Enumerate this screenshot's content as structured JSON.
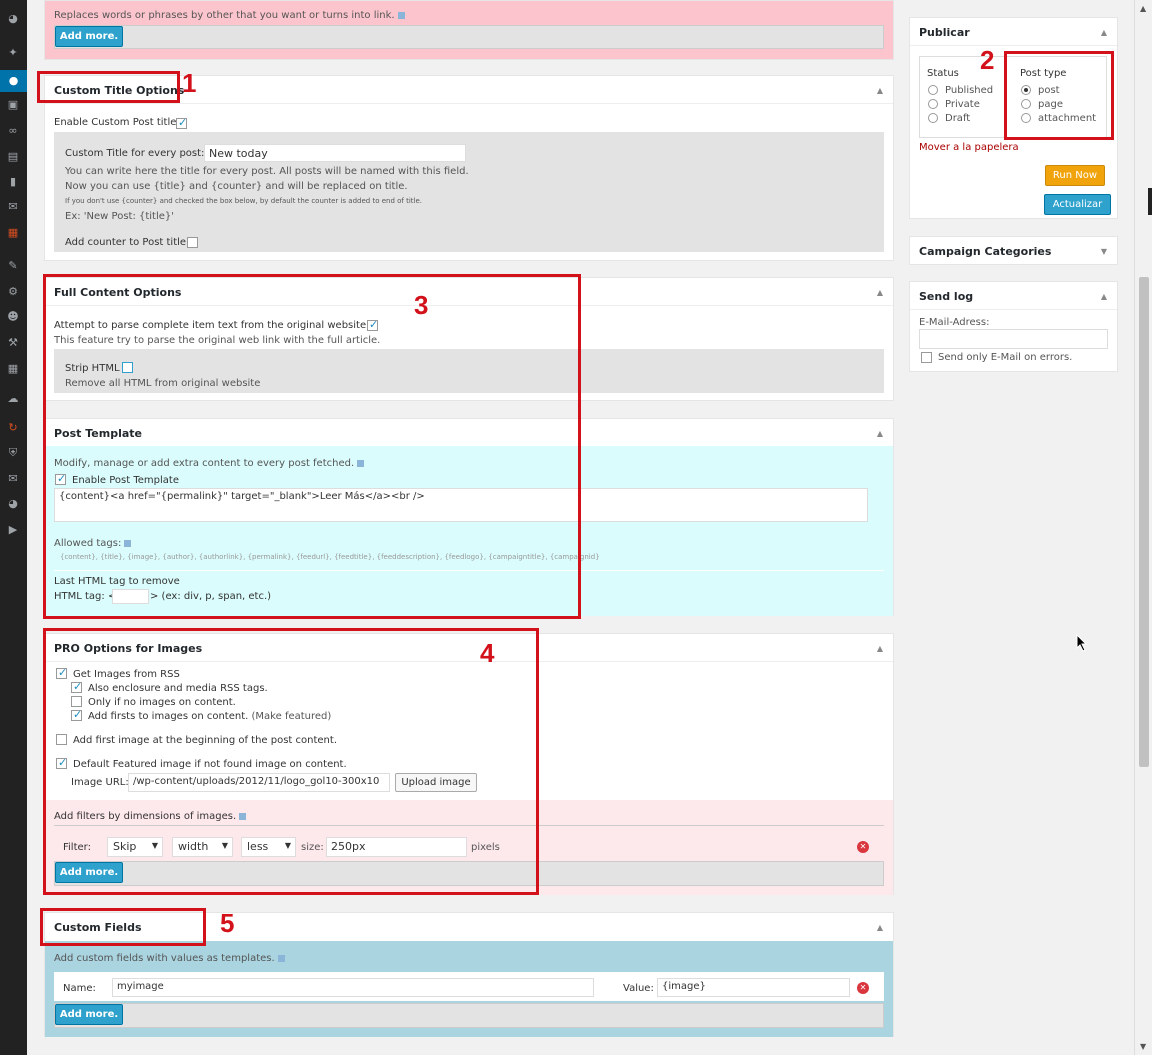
{
  "top_section": {
    "note": "Replaces words or phrases by other that you want or turns into link.",
    "add_more": "Add more."
  },
  "custom_title": {
    "heading": "Custom Title Options",
    "enable_label": "Enable Custom Post title",
    "field_label": "Custom Title for every post:",
    "field_value": "New today",
    "help1": "You can write here the title for every post. All posts will be named with this field.",
    "help2": "Now you can use {title} and {counter} and will be replaced on title.",
    "help3": "If you don't use {counter} and checked the box below, by default the counter is added to end of title.",
    "help4": "Ex: 'New Post: {title}'",
    "counter_label": "Add counter to Post title"
  },
  "full_content": {
    "heading": "Full Content Options",
    "parse_label": "Attempt to parse complete item text from the original website",
    "parse_help": "This feature try to parse the original web link with the full article.",
    "strip_label": "Strip HTML",
    "strip_help": "Remove all HTML from original website"
  },
  "post_template": {
    "heading": "Post Template",
    "intro": "Modify, manage or add extra content to every post fetched.",
    "enable_label": "Enable Post Template",
    "template_value": "{content}<a href=\"{permalink}\" target=\"_blank\">Leer Más</a><br />",
    "allowed_label": "Allowed tags:",
    "allowed_tags": "{content}, {title}, {image}, {author}, {authorlink}, {permalink}, {feedurl}, {feedtitle}, {feeddescription}, {feedlogo}, {campaigntitle}, {campaignid}",
    "last_tag_heading": "Last HTML tag to remove",
    "html_tag_label": "HTML tag: <",
    "html_tag_suffix": "> (ex: div, p, span, etc.)"
  },
  "pro_images": {
    "heading": "PRO Options for Images",
    "get_images": "Get Images from RSS",
    "enclosure": "Also enclosure and media RSS tags.",
    "only_if": "Only if no images on content.",
    "add_firsts": "Add firsts to images on content.",
    "make_featured": "(Make featured)",
    "add_first_image": "Add first image at the beginning of the post content.",
    "default_featured": "Default Featured image if not found image on content.",
    "image_url_label": "Image URL:",
    "image_url_value": "/wp-content/uploads/2012/11/logo_gol10-300x10",
    "upload_button": "Upload image",
    "filters_heading": "Add filters by dimensions of images.",
    "filter_label": "Filter:",
    "filter_action": "Skip",
    "filter_dim": "width",
    "filter_cmp": "less",
    "size_label": "size:",
    "size_value": "250px",
    "pixels_label": "pixels",
    "add_more": "Add more."
  },
  "custom_fields": {
    "heading": "Custom Fields",
    "intro": "Add custom fields with values as templates.",
    "name_label": "Name:",
    "name_value": "myimage",
    "value_label": "Value:",
    "value_value": "{image}",
    "add_more": "Add more."
  },
  "publish": {
    "heading": "Publicar",
    "status_label": "Status",
    "status_options": [
      "Published",
      "Private",
      "Draft"
    ],
    "post_type_label": "Post type",
    "post_type_options": [
      "post",
      "page",
      "attachment"
    ],
    "trash_link": "Mover a la papelera",
    "run_now": "Run Now",
    "update": "Actualizar"
  },
  "campaign_categories": {
    "heading": "Campaign Categories"
  },
  "send_log": {
    "heading": "Send log",
    "email_label": "E-Mail-Adress:",
    "only_errors": "Send only E-Mail on errors."
  },
  "annotations": [
    "1",
    "2",
    "3",
    "4",
    "5"
  ],
  "colors": {
    "accent_red": "#d2111a",
    "button_blue": "#2ea2cc",
    "run_now_orange": "#f0a30a",
    "cyan_panel": "#dafcfc",
    "pink_panel": "#fde8ec"
  }
}
